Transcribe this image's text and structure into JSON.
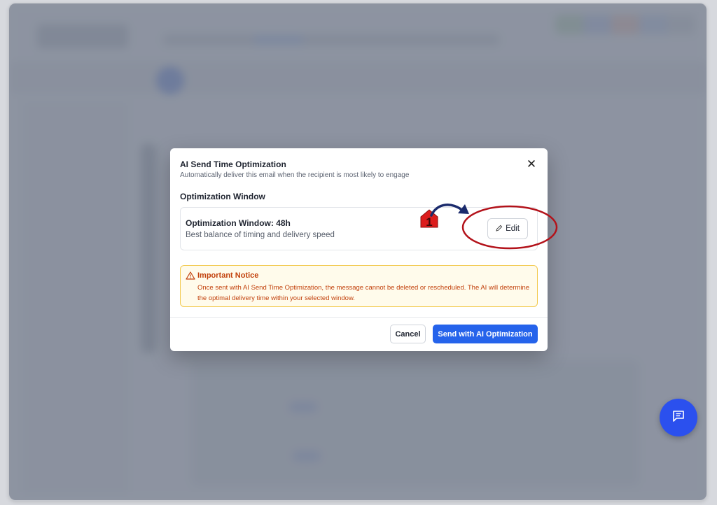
{
  "modal": {
    "title": "AI Send Time Optimization",
    "subtitle": "Automatically deliver this email when the recipient is most likely to engage",
    "close_icon": "close-icon",
    "section_label": "Optimization Window",
    "window_card": {
      "title": "Optimization Window: 48h",
      "description": "Best balance of timing and delivery speed",
      "edit_label": "Edit",
      "edit_icon": "pencil-icon"
    },
    "notice": {
      "icon": "warning-triangle-icon",
      "title": "Important Notice",
      "text": "Once sent with AI Send Time Optimization, the message cannot be deleted or rescheduled. The AI will determine the optimal delivery time within your selected window."
    },
    "footer": {
      "cancel_label": "Cancel",
      "send_label": "Send with AI Optimization"
    }
  },
  "annotation": {
    "step_number": "1",
    "color_marker": "#dc1c1c",
    "color_circle": "#b3121a",
    "color_arrow": "#1a2a6c"
  },
  "chat_button": {
    "icon": "chat-message-icon"
  },
  "colors": {
    "primary": "#2563eb",
    "notice_text": "#c2410c",
    "notice_border": "#f2c94c",
    "notice_bg": "#fffbeb"
  }
}
